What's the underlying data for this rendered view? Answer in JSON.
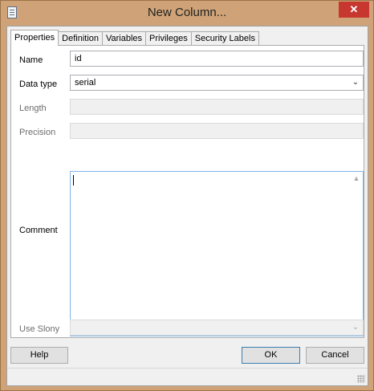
{
  "window": {
    "title": "New Column...",
    "close_glyph": "✕"
  },
  "tabs": [
    {
      "label": "Properties",
      "active": true
    },
    {
      "label": "Definition",
      "active": false
    },
    {
      "label": "Variables",
      "active": false
    },
    {
      "label": "Privileges",
      "active": false
    },
    {
      "label": "Security Labels",
      "active": false
    }
  ],
  "form": {
    "name_label": "Name",
    "name_value": "id",
    "data_type_label": "Data type",
    "data_type_value": "serial",
    "length_label": "Length",
    "length_value": "",
    "precision_label": "Precision",
    "precision_value": "",
    "comment_label": "Comment",
    "comment_value": "",
    "use_slony_label": "Use Slony",
    "use_slony_value": ""
  },
  "buttons": {
    "help": "Help",
    "ok": "OK",
    "cancel": "Cancel"
  },
  "icons": {
    "combo_arrow": "⌄",
    "scroll_up": "▲",
    "scroll_down": "▼",
    "app_icon": "form-icon"
  },
  "colors": {
    "frame": "#cfa377",
    "close_button": "#c7372f",
    "focus_border": "#7eb4ea"
  }
}
